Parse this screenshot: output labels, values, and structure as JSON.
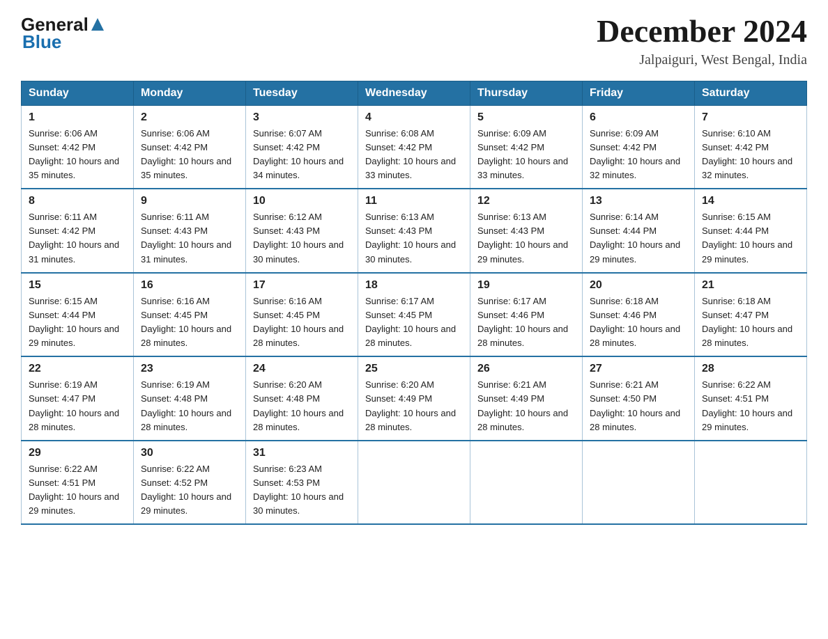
{
  "header": {
    "logo_general": "General",
    "logo_blue": "Blue",
    "title": "December 2024",
    "subtitle": "Jalpaiguri, West Bengal, India"
  },
  "days_of_week": [
    "Sunday",
    "Monday",
    "Tuesday",
    "Wednesday",
    "Thursday",
    "Friday",
    "Saturday"
  ],
  "weeks": [
    [
      {
        "day": "1",
        "sunrise": "6:06 AM",
        "sunset": "4:42 PM",
        "daylight": "10 hours and 35 minutes."
      },
      {
        "day": "2",
        "sunrise": "6:06 AM",
        "sunset": "4:42 PM",
        "daylight": "10 hours and 35 minutes."
      },
      {
        "day": "3",
        "sunrise": "6:07 AM",
        "sunset": "4:42 PM",
        "daylight": "10 hours and 34 minutes."
      },
      {
        "day": "4",
        "sunrise": "6:08 AM",
        "sunset": "4:42 PM",
        "daylight": "10 hours and 33 minutes."
      },
      {
        "day": "5",
        "sunrise": "6:09 AM",
        "sunset": "4:42 PM",
        "daylight": "10 hours and 33 minutes."
      },
      {
        "day": "6",
        "sunrise": "6:09 AM",
        "sunset": "4:42 PM",
        "daylight": "10 hours and 32 minutes."
      },
      {
        "day": "7",
        "sunrise": "6:10 AM",
        "sunset": "4:42 PM",
        "daylight": "10 hours and 32 minutes."
      }
    ],
    [
      {
        "day": "8",
        "sunrise": "6:11 AM",
        "sunset": "4:42 PM",
        "daylight": "10 hours and 31 minutes."
      },
      {
        "day": "9",
        "sunrise": "6:11 AM",
        "sunset": "4:43 PM",
        "daylight": "10 hours and 31 minutes."
      },
      {
        "day": "10",
        "sunrise": "6:12 AM",
        "sunset": "4:43 PM",
        "daylight": "10 hours and 30 minutes."
      },
      {
        "day": "11",
        "sunrise": "6:13 AM",
        "sunset": "4:43 PM",
        "daylight": "10 hours and 30 minutes."
      },
      {
        "day": "12",
        "sunrise": "6:13 AM",
        "sunset": "4:43 PM",
        "daylight": "10 hours and 29 minutes."
      },
      {
        "day": "13",
        "sunrise": "6:14 AM",
        "sunset": "4:44 PM",
        "daylight": "10 hours and 29 minutes."
      },
      {
        "day": "14",
        "sunrise": "6:15 AM",
        "sunset": "4:44 PM",
        "daylight": "10 hours and 29 minutes."
      }
    ],
    [
      {
        "day": "15",
        "sunrise": "6:15 AM",
        "sunset": "4:44 PM",
        "daylight": "10 hours and 29 minutes."
      },
      {
        "day": "16",
        "sunrise": "6:16 AM",
        "sunset": "4:45 PM",
        "daylight": "10 hours and 28 minutes."
      },
      {
        "day": "17",
        "sunrise": "6:16 AM",
        "sunset": "4:45 PM",
        "daylight": "10 hours and 28 minutes."
      },
      {
        "day": "18",
        "sunrise": "6:17 AM",
        "sunset": "4:45 PM",
        "daylight": "10 hours and 28 minutes."
      },
      {
        "day": "19",
        "sunrise": "6:17 AM",
        "sunset": "4:46 PM",
        "daylight": "10 hours and 28 minutes."
      },
      {
        "day": "20",
        "sunrise": "6:18 AM",
        "sunset": "4:46 PM",
        "daylight": "10 hours and 28 minutes."
      },
      {
        "day": "21",
        "sunrise": "6:18 AM",
        "sunset": "4:47 PM",
        "daylight": "10 hours and 28 minutes."
      }
    ],
    [
      {
        "day": "22",
        "sunrise": "6:19 AM",
        "sunset": "4:47 PM",
        "daylight": "10 hours and 28 minutes."
      },
      {
        "day": "23",
        "sunrise": "6:19 AM",
        "sunset": "4:48 PM",
        "daylight": "10 hours and 28 minutes."
      },
      {
        "day": "24",
        "sunrise": "6:20 AM",
        "sunset": "4:48 PM",
        "daylight": "10 hours and 28 minutes."
      },
      {
        "day": "25",
        "sunrise": "6:20 AM",
        "sunset": "4:49 PM",
        "daylight": "10 hours and 28 minutes."
      },
      {
        "day": "26",
        "sunrise": "6:21 AM",
        "sunset": "4:49 PM",
        "daylight": "10 hours and 28 minutes."
      },
      {
        "day": "27",
        "sunrise": "6:21 AM",
        "sunset": "4:50 PM",
        "daylight": "10 hours and 28 minutes."
      },
      {
        "day": "28",
        "sunrise": "6:22 AM",
        "sunset": "4:51 PM",
        "daylight": "10 hours and 29 minutes."
      }
    ],
    [
      {
        "day": "29",
        "sunrise": "6:22 AM",
        "sunset": "4:51 PM",
        "daylight": "10 hours and 29 minutes."
      },
      {
        "day": "30",
        "sunrise": "6:22 AM",
        "sunset": "4:52 PM",
        "daylight": "10 hours and 29 minutes."
      },
      {
        "day": "31",
        "sunrise": "6:23 AM",
        "sunset": "4:53 PM",
        "daylight": "10 hours and 30 minutes."
      },
      null,
      null,
      null,
      null
    ]
  ]
}
